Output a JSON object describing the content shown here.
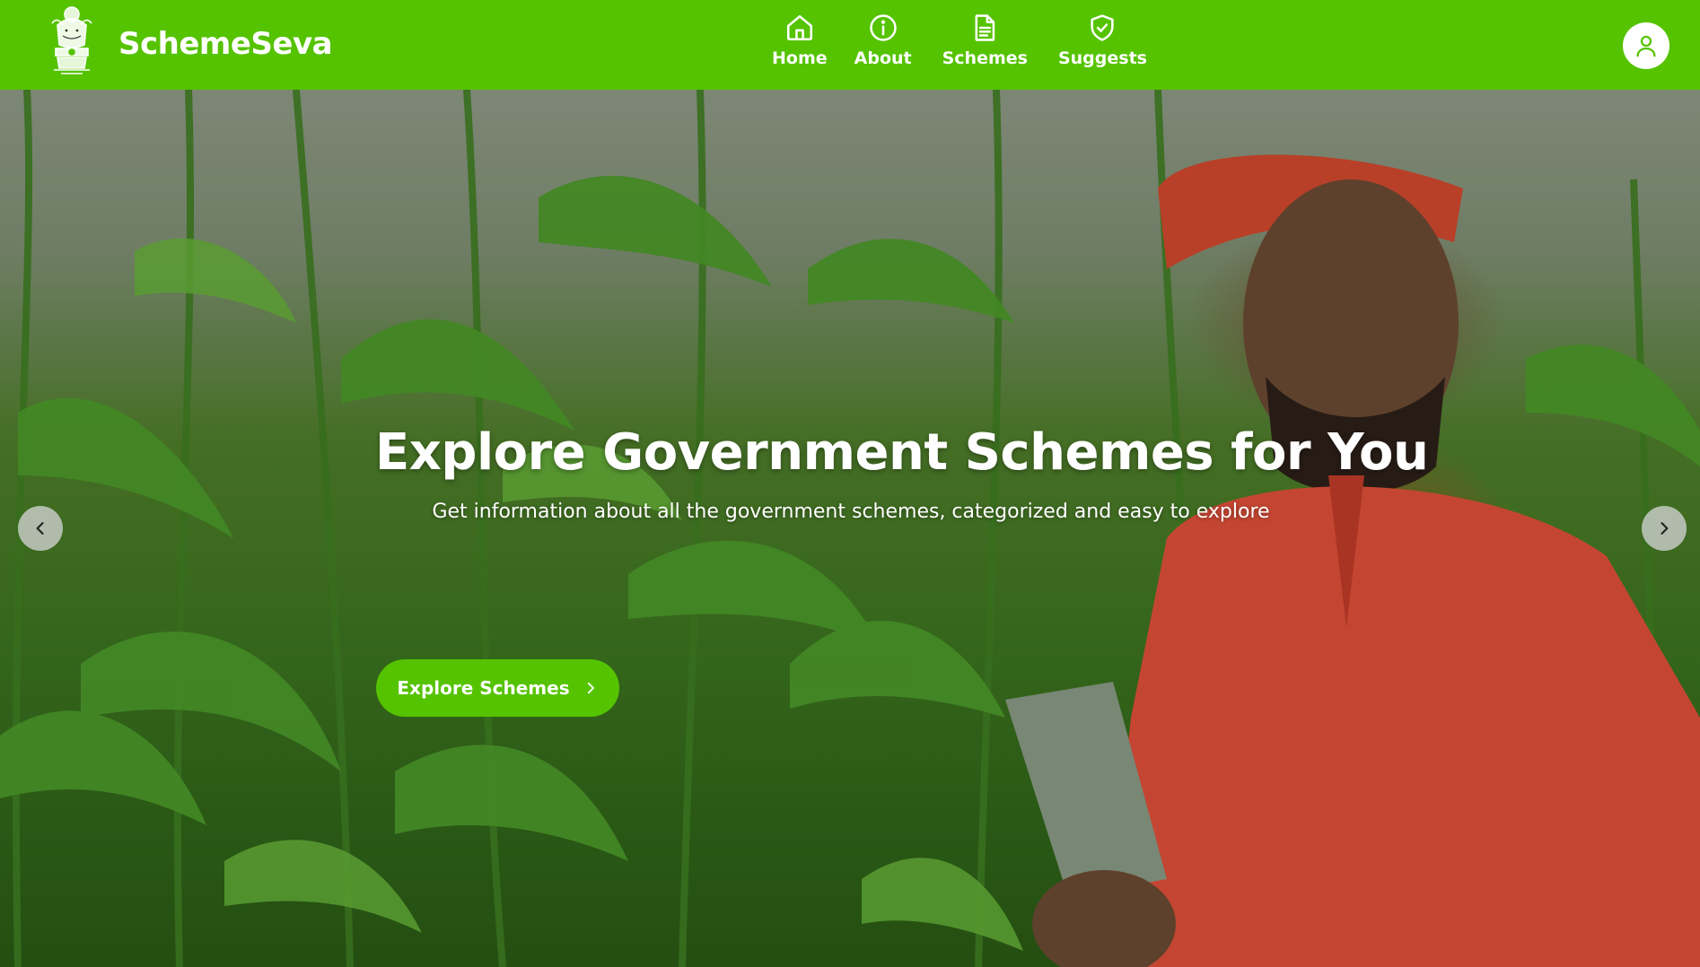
{
  "brand": {
    "name": "SchemeSeva",
    "emblem_icon": "national-emblem-icon"
  },
  "nav": {
    "items": [
      {
        "label": "Home",
        "icon": "home-icon"
      },
      {
        "label": "About",
        "icon": "info-icon"
      },
      {
        "label": "Schemes",
        "icon": "document-icon"
      },
      {
        "label": "Suggests",
        "icon": "shield-check-icon"
      }
    ]
  },
  "profile": {
    "icon": "user-icon"
  },
  "hero": {
    "title": "Explore Government Schemes for You",
    "subtitle": "Get information about all the government schemes, categorized and easy to explore",
    "cta_label": "Explore Schemes",
    "cta_icon": "chevron-right-icon",
    "prev_icon": "chevron-left-icon",
    "next_icon": "chevron-right-icon"
  },
  "colors": {
    "brand_green": "#55c300",
    "text_on_brand": "#ffffff"
  }
}
